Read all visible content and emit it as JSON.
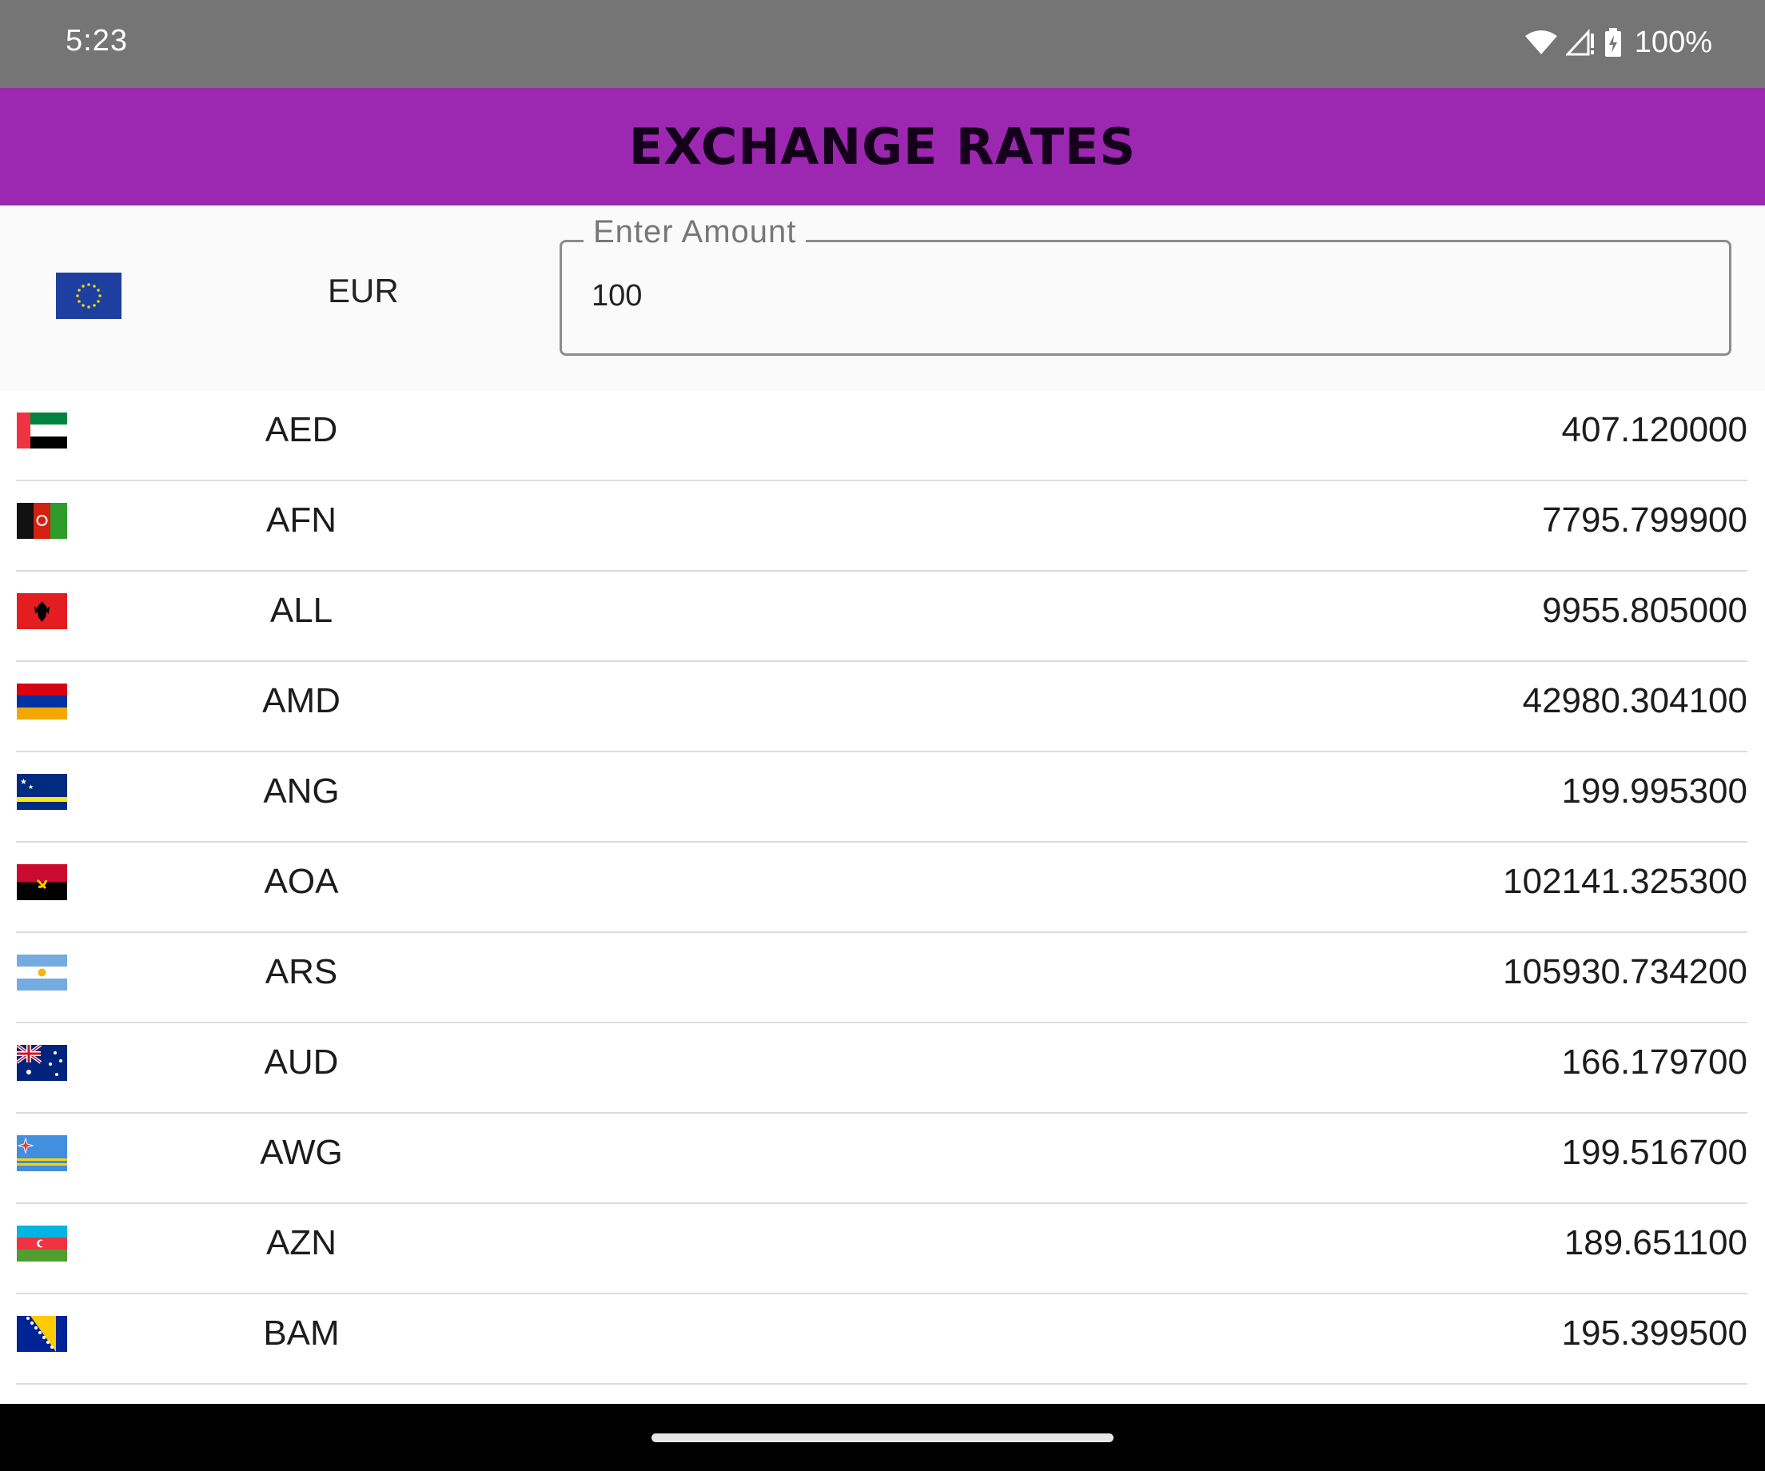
{
  "status_bar": {
    "time": "5:23",
    "battery": "100%",
    "icons": [
      "wifi-icon",
      "signal-icon",
      "battery-charging-icon"
    ]
  },
  "app_bar": {
    "title": "EXCHANGE RATES",
    "color": "#9c27b0"
  },
  "base": {
    "flag": "eu-flag-icon",
    "code": "EUR",
    "amount_label": "Enter Amount",
    "amount_value": "100"
  },
  "rates": [
    {
      "code": "AED",
      "value": "407.120000",
      "flag": "ae-flag-icon"
    },
    {
      "code": "AFN",
      "value": "7795.799900",
      "flag": "af-flag-icon"
    },
    {
      "code": "ALL",
      "value": "9955.805000",
      "flag": "al-flag-icon"
    },
    {
      "code": "AMD",
      "value": "42980.304100",
      "flag": "am-flag-icon"
    },
    {
      "code": "ANG",
      "value": "199.995300",
      "flag": "cw-flag-icon"
    },
    {
      "code": "AOA",
      "value": "102141.325300",
      "flag": "ao-flag-icon"
    },
    {
      "code": "ARS",
      "value": "105930.734200",
      "flag": "ar-flag-icon"
    },
    {
      "code": "AUD",
      "value": "166.179700",
      "flag": "au-flag-icon"
    },
    {
      "code": "AWG",
      "value": "199.516700",
      "flag": "aw-flag-icon"
    },
    {
      "code": "AZN",
      "value": "189.651100",
      "flag": "az-flag-icon"
    },
    {
      "code": "BAM",
      "value": "195.399500",
      "flag": "ba-flag-icon"
    }
  ]
}
